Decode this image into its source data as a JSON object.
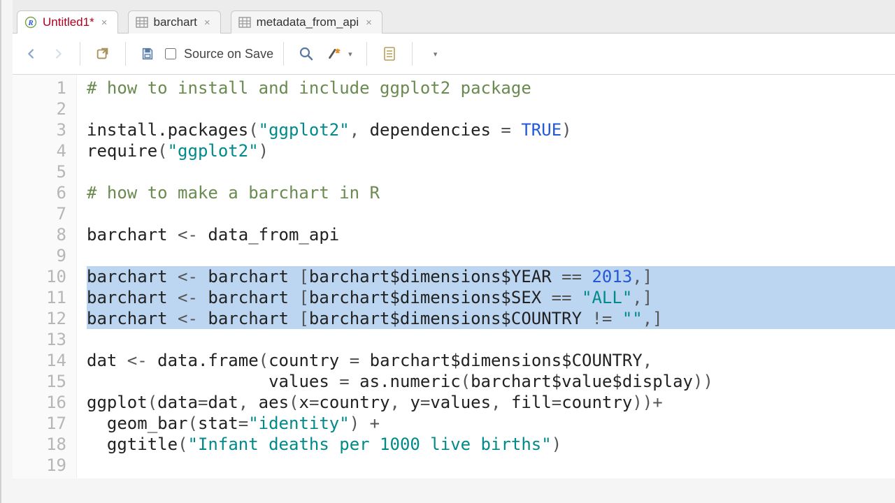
{
  "tabs": [
    {
      "label": "Untitled1",
      "dirty": true,
      "icon": "rscript",
      "active": true
    },
    {
      "label": "barchart",
      "dirty": false,
      "icon": "table",
      "active": false
    },
    {
      "label": "metadata_from_api",
      "dirty": false,
      "icon": "table",
      "active": false
    }
  ],
  "toolbar": {
    "source_on_save_label": "Source on Save",
    "source_on_save_checked": false
  },
  "editor": {
    "line_count": 19,
    "selected_lines": [
      10,
      11,
      12
    ],
    "lines": [
      {
        "n": 1,
        "tokens": [
          {
            "c": "cmt",
            "t": "# how to install and include ggplot2 package"
          }
        ]
      },
      {
        "n": 2,
        "tokens": [
          {
            "c": "",
            "t": ""
          }
        ]
      },
      {
        "n": 3,
        "tokens": [
          {
            "c": "idn",
            "t": "install.packages"
          },
          {
            "c": "op",
            "t": "("
          },
          {
            "c": "str",
            "t": "\"ggplot2\""
          },
          {
            "c": "op",
            "t": ", "
          },
          {
            "c": "idn",
            "t": "dependencies"
          },
          {
            "c": "op",
            "t": " = "
          },
          {
            "c": "bool",
            "t": "TRUE"
          },
          {
            "c": "op",
            "t": ")"
          }
        ]
      },
      {
        "n": 4,
        "tokens": [
          {
            "c": "idn",
            "t": "require"
          },
          {
            "c": "op",
            "t": "("
          },
          {
            "c": "str",
            "t": "\"ggplot2\""
          },
          {
            "c": "op",
            "t": ")"
          }
        ]
      },
      {
        "n": 5,
        "tokens": [
          {
            "c": "",
            "t": ""
          }
        ]
      },
      {
        "n": 6,
        "tokens": [
          {
            "c": "cmt",
            "t": "# how to make a barchart in R"
          }
        ]
      },
      {
        "n": 7,
        "tokens": [
          {
            "c": "",
            "t": ""
          }
        ]
      },
      {
        "n": 8,
        "tokens": [
          {
            "c": "idn",
            "t": "barchart"
          },
          {
            "c": "op",
            "t": " <- "
          },
          {
            "c": "idn",
            "t": "data_from_api"
          }
        ]
      },
      {
        "n": 9,
        "tokens": [
          {
            "c": "",
            "t": ""
          }
        ]
      },
      {
        "n": 10,
        "tokens": [
          {
            "c": "idn",
            "t": "barchart"
          },
          {
            "c": "op",
            "t": " <- "
          },
          {
            "c": "idn",
            "t": "barchart "
          },
          {
            "c": "op",
            "t": "["
          },
          {
            "c": "idn",
            "t": "barchart$dimensions$YEAR"
          },
          {
            "c": "op",
            "t": " == "
          },
          {
            "c": "num",
            "t": "2013"
          },
          {
            "c": "op",
            "t": ",]"
          }
        ]
      },
      {
        "n": 11,
        "tokens": [
          {
            "c": "idn",
            "t": "barchart"
          },
          {
            "c": "op",
            "t": " <- "
          },
          {
            "c": "idn",
            "t": "barchart "
          },
          {
            "c": "op",
            "t": "["
          },
          {
            "c": "idn",
            "t": "barchart$dimensions$SEX"
          },
          {
            "c": "op",
            "t": " == "
          },
          {
            "c": "str",
            "t": "\"ALL\""
          },
          {
            "c": "op",
            "t": ",]"
          }
        ]
      },
      {
        "n": 12,
        "tokens": [
          {
            "c": "idn",
            "t": "barchart"
          },
          {
            "c": "op",
            "t": " <- "
          },
          {
            "c": "idn",
            "t": "barchart "
          },
          {
            "c": "op",
            "t": "["
          },
          {
            "c": "idn",
            "t": "barchart$dimensions$COUNTRY"
          },
          {
            "c": "op",
            "t": " != "
          },
          {
            "c": "str",
            "t": "\"\""
          },
          {
            "c": "op",
            "t": ",]"
          }
        ]
      },
      {
        "n": 13,
        "tokens": [
          {
            "c": "",
            "t": ""
          }
        ]
      },
      {
        "n": 14,
        "tokens": [
          {
            "c": "idn",
            "t": "dat"
          },
          {
            "c": "op",
            "t": " <- "
          },
          {
            "c": "idn",
            "t": "data.frame"
          },
          {
            "c": "op",
            "t": "("
          },
          {
            "c": "idn",
            "t": "country"
          },
          {
            "c": "op",
            "t": " = "
          },
          {
            "c": "idn",
            "t": "barchart$dimensions$COUNTRY"
          },
          {
            "c": "op",
            "t": ","
          }
        ]
      },
      {
        "n": 15,
        "tokens": [
          {
            "c": "",
            "t": "                  "
          },
          {
            "c": "idn",
            "t": "values"
          },
          {
            "c": "op",
            "t": " = "
          },
          {
            "c": "idn",
            "t": "as.numeric"
          },
          {
            "c": "op",
            "t": "("
          },
          {
            "c": "idn",
            "t": "barchart$value$display"
          },
          {
            "c": "op",
            "t": "))"
          }
        ]
      },
      {
        "n": 16,
        "tokens": [
          {
            "c": "idn",
            "t": "ggplot"
          },
          {
            "c": "op",
            "t": "("
          },
          {
            "c": "idn",
            "t": "data"
          },
          {
            "c": "op",
            "t": "="
          },
          {
            "c": "idn",
            "t": "dat"
          },
          {
            "c": "op",
            "t": ", "
          },
          {
            "c": "idn",
            "t": "aes"
          },
          {
            "c": "op",
            "t": "("
          },
          {
            "c": "idn",
            "t": "x"
          },
          {
            "c": "op",
            "t": "="
          },
          {
            "c": "idn",
            "t": "country"
          },
          {
            "c": "op",
            "t": ", "
          },
          {
            "c": "idn",
            "t": "y"
          },
          {
            "c": "op",
            "t": "="
          },
          {
            "c": "idn",
            "t": "values"
          },
          {
            "c": "op",
            "t": ", "
          },
          {
            "c": "idn",
            "t": "fill"
          },
          {
            "c": "op",
            "t": "="
          },
          {
            "c": "idn",
            "t": "country"
          },
          {
            "c": "op",
            "t": "))+"
          }
        ]
      },
      {
        "n": 17,
        "tokens": [
          {
            "c": "",
            "t": "  "
          },
          {
            "c": "idn",
            "t": "geom_bar"
          },
          {
            "c": "op",
            "t": "("
          },
          {
            "c": "idn",
            "t": "stat"
          },
          {
            "c": "op",
            "t": "="
          },
          {
            "c": "str",
            "t": "\"identity\""
          },
          {
            "c": "op",
            "t": ") +"
          }
        ]
      },
      {
        "n": 18,
        "tokens": [
          {
            "c": "",
            "t": "  "
          },
          {
            "c": "idn",
            "t": "ggtitle"
          },
          {
            "c": "op",
            "t": "("
          },
          {
            "c": "str",
            "t": "\"Infant deaths per 1000 live births\""
          },
          {
            "c": "op",
            "t": ")"
          }
        ]
      },
      {
        "n": 19,
        "tokens": [
          {
            "c": "",
            "t": ""
          }
        ]
      }
    ]
  }
}
